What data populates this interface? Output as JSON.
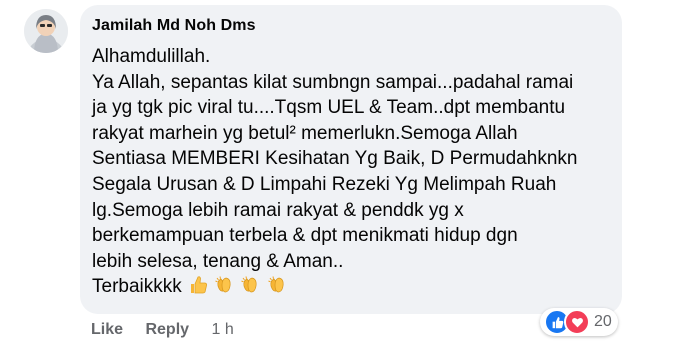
{
  "comment": {
    "author": "Jamilah Md Noh Dms",
    "lines": [
      "Alhamdulillah.",
      "Ya Allah, sepantas kilat sumbngn sampai...padahal ramai",
      "ja yg tgk pic viral tu....Tqsm UEL & Team..dpt membantu",
      "rakyat marhein yg betul² memerlukn.Semoga Allah",
      "Sentiasa MEMBERI Kesihatan Yg Baik, D Permudahknkn",
      "Segala Urusan & D Limpahi Rezeki Yg Melimpah Ruah",
      "lg.Semoga lebih ramai rakyat & penddk yg x",
      "berkemampuan terbela & dpt menikmati hidup dgn",
      "lebih selesa, tenang & Aman..",
      "Terbaikkkk"
    ],
    "emojis": [
      "thumbs-up-icon",
      "clapping-hands-icon",
      "clapping-hands-icon",
      "clapping-hands-icon"
    ],
    "bubble_color": "#f0f2f5"
  },
  "actions": {
    "like": "Like",
    "reply": "Reply",
    "time": "1 h"
  },
  "reactions": {
    "icons": [
      "like-reaction-icon",
      "love-reaction-icon"
    ],
    "count": "20",
    "like_color": "#1877f2",
    "love_color": "#f33e58"
  }
}
